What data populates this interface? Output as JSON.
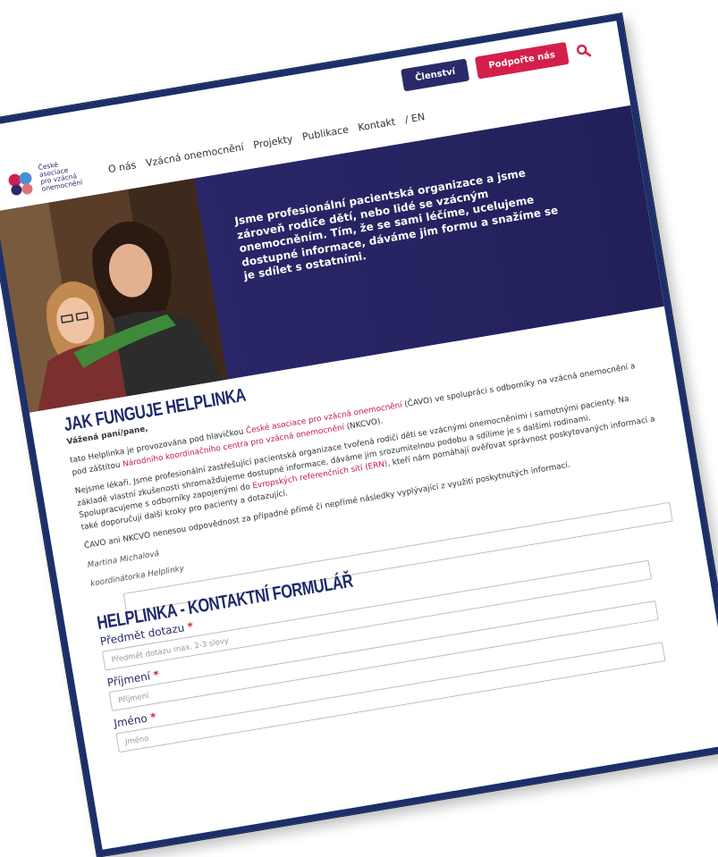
{
  "header": {
    "logo_lines": [
      "České",
      "asociace",
      "pro vzácná",
      "onemocnění"
    ],
    "nav": [
      "O nás",
      "Vzácná onemocnění",
      "Projekty",
      "Publikace",
      "Kontakt",
      "/ EN"
    ],
    "membership_label": "Členství",
    "support_label": "Podpořte nás"
  },
  "hero": {
    "text": "Jsme profesionální pacientská organizace a jsme zároveň rodiče dětí, nebo lidé se vzácným onemocněním. Tím, že se sami léčíme, ucelujeme dostupné informace, dáváme jim formu a snažíme se je sdílet s ostatními."
  },
  "main": {
    "title": "JAK FUNGUJE HELPLINKA",
    "greeting": "Vážená paní/pane,",
    "p1": {
      "a": "tato Helplinka je provozována pod hlavičkou ",
      "link1": "České asociace pro vzácná onemocnění",
      "b": " (ČAVO) ve spolupráci s odborníky na vzácná onemocnění a pod záštitou ",
      "link2": "Národního koordinačního centra pro vzácná onemocnění",
      "c": " (NKCVO)."
    },
    "p2": {
      "a": "Nejsme lékaři. Jsme profesionální zastřešující pacientská organizace tvořená rodiči dětí se vzácnými onemocněními i samotnými pacienty. Na základě vlastní zkušenosti shromažďujeme dostupné informace, dáváme jim srozumitelnou podobu a sdílíme je s dalšími rodinami. Spolupracujeme s odborníky zapojenými do ",
      "link": "Evropských referenčních sítí (ERN)",
      "b": ", kteří nám pomáhají ověřovat správnost poskytovaných informací a také doporučují další kroky pro pacienty a dotazující."
    },
    "p3": "ČAVO ani NKCVO nenesou odpovědnost za případné přímé či nepřímé následky vyplývající z využití poskytnutých informací.",
    "signature_name": "Martina Michalová",
    "signature_role": "koordinátorka Helplinky",
    "form_title": "HELPLINKA - KONTAKTNÍ FORMULÁŘ",
    "fields": [
      {
        "label": "Předmět dotazu",
        "required_mark": "*",
        "placeholder": "Předmět dotazu max. 2-3 slovy"
      },
      {
        "label": "Příjmení",
        "required_mark": "*",
        "placeholder": "Příjmení"
      },
      {
        "label": "Jméno",
        "required_mark": "*",
        "placeholder": "Jméno"
      }
    ]
  },
  "colors": {
    "navy": "#2a2a6a",
    "brand_pink": "#d51f4b",
    "link_pink": "#c2185b",
    "frame": "#1c2f6b"
  }
}
